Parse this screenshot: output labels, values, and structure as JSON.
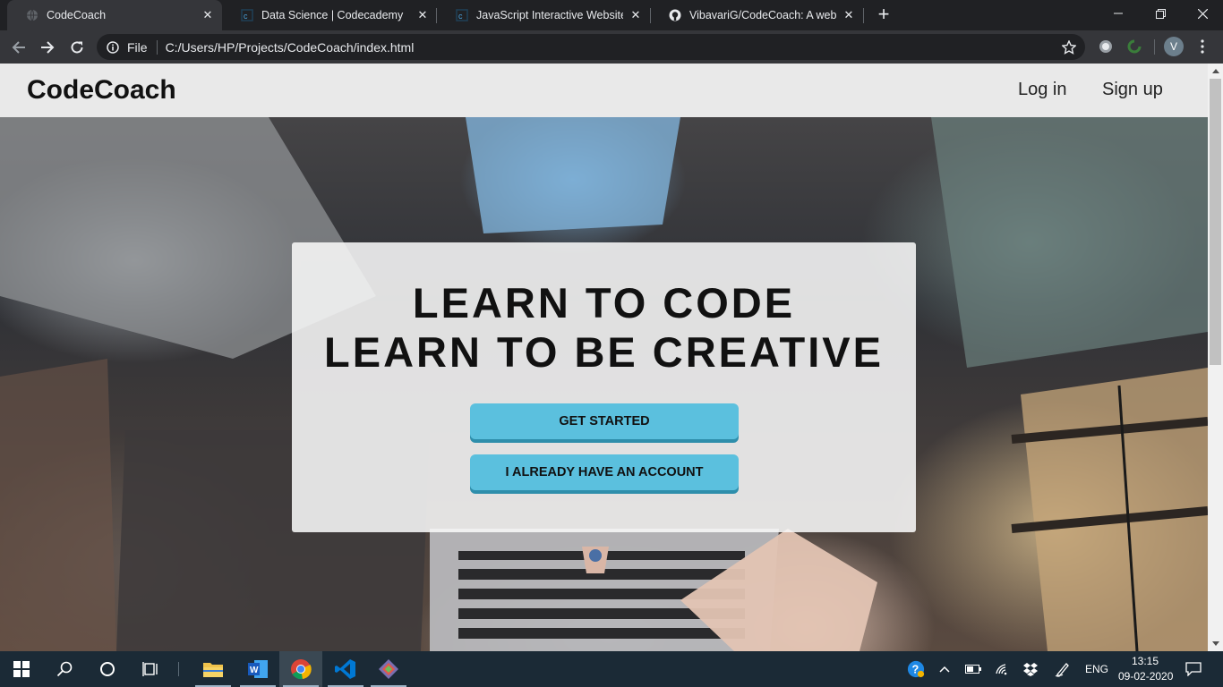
{
  "browser": {
    "tabs": [
      {
        "title": "CodeCoach",
        "active": true,
        "favicon": "globe-icon"
      },
      {
        "title": "Data Science | Codecademy",
        "active": false,
        "favicon": "codecademy-icon"
      },
      {
        "title": "JavaScript Interactive Websites | C",
        "active": false,
        "favicon": "codecademy-icon"
      },
      {
        "title": "VibavariG/CodeCoach: A website",
        "active": false,
        "favicon": "github-icon"
      }
    ],
    "scheme_label": "File",
    "url": "C:/Users/HP/Projects/CodeCoach/index.html",
    "profile_initial": "V"
  },
  "site": {
    "brand": "CodeCoach",
    "nav": {
      "login": "Log in",
      "signup": "Sign up"
    },
    "hero": {
      "line1": "LEARN TO CODE",
      "line2": "LEARN TO BE CREATIVE",
      "primary_button": "GET STARTED",
      "secondary_button": "I ALREADY HAVE AN ACCOUNT"
    },
    "accent_color": "#5bc0de"
  },
  "taskbar": {
    "language": "ENG",
    "time": "13:15",
    "date": "09-02-2020"
  }
}
